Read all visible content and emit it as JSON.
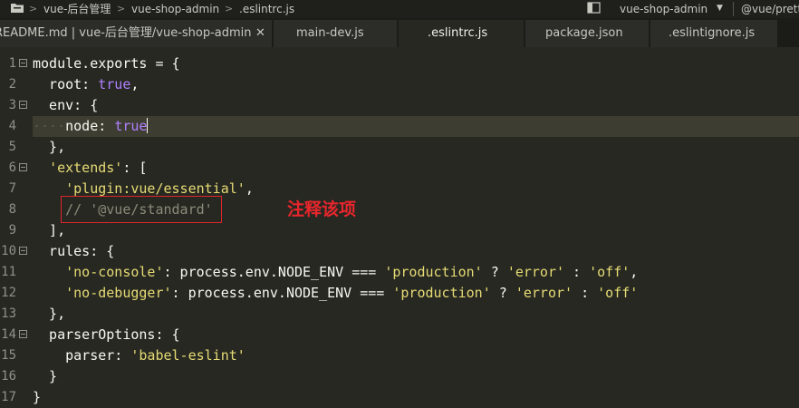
{
  "breadcrumb": {
    "items": [
      "vue-后台管理",
      "vue-shop-admin",
      ".eslintrc.js"
    ],
    "separator": ">",
    "project": "vue-shop-admin",
    "extension": "@vue/prett"
  },
  "tabs": [
    {
      "label": "README.md | vue-后台管理/vue-shop-admin",
      "close": "✕",
      "active": false
    },
    {
      "label": "main-dev.js",
      "active": false
    },
    {
      "label": ".eslintrc.js",
      "active": true
    },
    {
      "label": "package.json",
      "active": false
    },
    {
      "label": ".eslintignore.js",
      "active": false
    }
  ],
  "code": {
    "line_numbers": [
      "1",
      "2",
      "3",
      "4",
      "5",
      "6",
      "7",
      "8",
      "9",
      "10",
      "11",
      "12",
      "13",
      "14",
      "15",
      "16",
      "17"
    ],
    "l1": "module.exports = {",
    "l2_key": "  root: ",
    "l2_val": "true",
    "l2_end": ",",
    "l3": "  env: {",
    "l4_dots": "····",
    "l4_key": "node: ",
    "l4_val": "true",
    "l5": "  },",
    "l6_str": "'extends'",
    "l6_rest": ": [",
    "l7_str": "'plugin:vue/essential'",
    "l7_end": ",",
    "l8_comment": "// '@vue/standard'",
    "l9": "  ],",
    "l10": "  rules: {",
    "l11_key": "'no-console'",
    "l11_a": ": process.env.NODE_ENV === ",
    "l11_b": "'production'",
    "l11_c": " ? ",
    "l11_d": "'error'",
    "l11_e": " : ",
    "l11_f": "'off'",
    "l11_g": ",",
    "l12_key": "'no-debugger'",
    "l12_a": ": process.env.NODE_ENV === ",
    "l12_b": "'production'",
    "l12_c": " ? ",
    "l12_d": "'error'",
    "l12_e": " : ",
    "l12_f": "'off'",
    "l13": "  },",
    "l14": "  parserOptions: {",
    "l15_key": "    parser: ",
    "l15_val": "'babel-eslint'",
    "l16": "  }",
    "l17": "}"
  },
  "annotation": "注释该项",
  "colors": {
    "background": "#272822",
    "string": "#e6db74",
    "keyword": "#ae81ff",
    "comment": "#8c8a79",
    "annotation": "#e8262c"
  }
}
